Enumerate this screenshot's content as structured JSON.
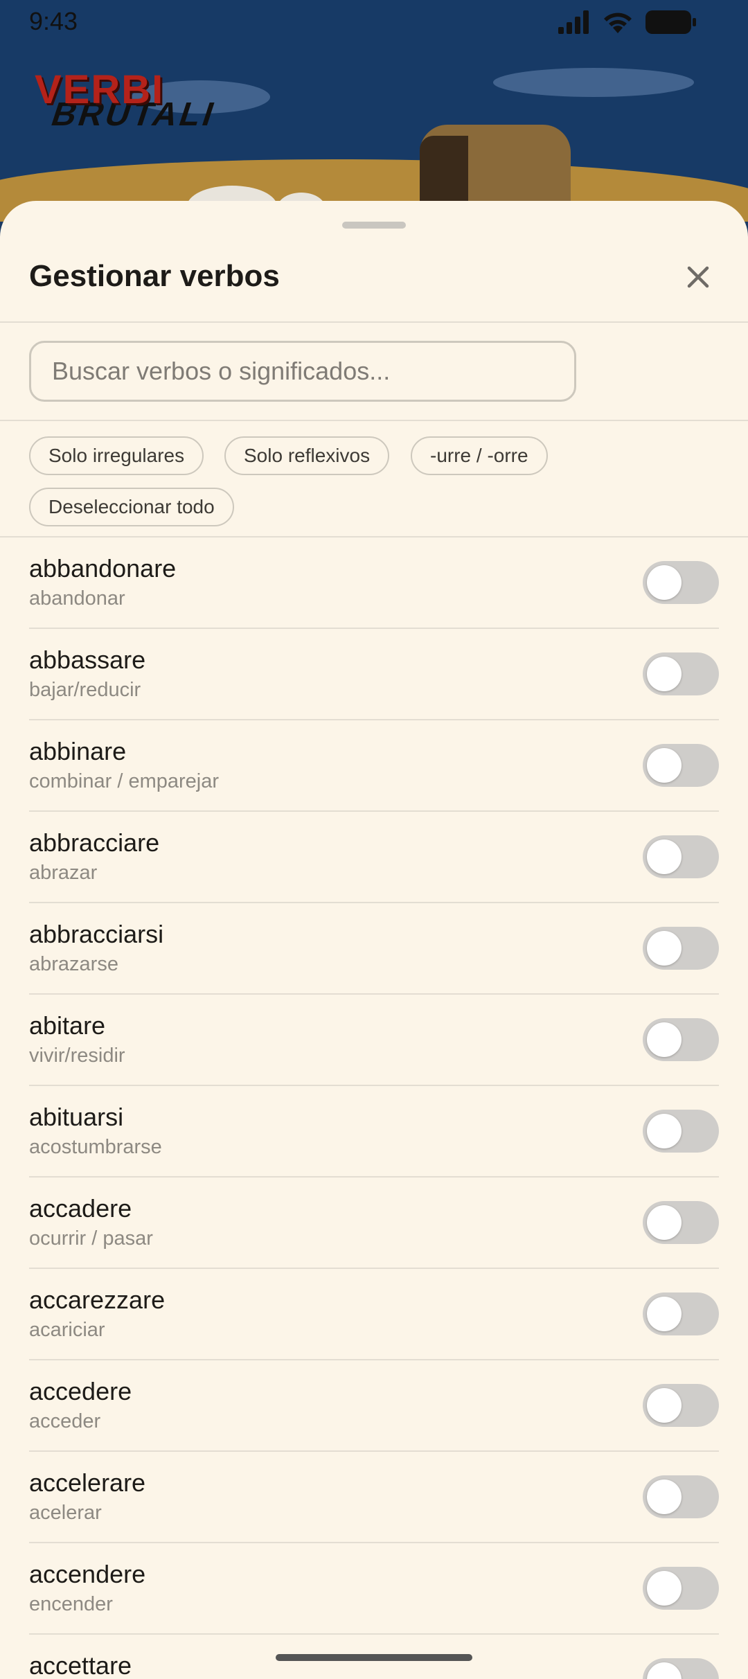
{
  "status_bar": {
    "time": "9:43"
  },
  "app": {
    "logo_main": "VERBI",
    "logo_sub": "BRUTALI"
  },
  "sheet": {
    "title": "Gestionar verbos",
    "search_placeholder": "Buscar verbos o significados...",
    "filters": [
      {
        "label": "Solo irregulares"
      },
      {
        "label": "Solo reflexivos"
      },
      {
        "label": "-urre / -orre"
      },
      {
        "label": "Deseleccionar todo"
      }
    ],
    "verbs": [
      {
        "name": "abbandonare",
        "meaning": "abandonar",
        "enabled": false
      },
      {
        "name": "abbassare",
        "meaning": "bajar/reducir",
        "enabled": false
      },
      {
        "name": "abbinare",
        "meaning": "combinar / emparejar",
        "enabled": false
      },
      {
        "name": "abbracciare",
        "meaning": "abrazar",
        "enabled": false
      },
      {
        "name": "abbracciarsi",
        "meaning": "abrazarse",
        "enabled": false
      },
      {
        "name": "abitare",
        "meaning": "vivir/residir",
        "enabled": false
      },
      {
        "name": "abituarsi",
        "meaning": "acostumbrarse",
        "enabled": false
      },
      {
        "name": "accadere",
        "meaning": "ocurrir / pasar",
        "enabled": false
      },
      {
        "name": "accarezzare",
        "meaning": "acariciar",
        "enabled": false
      },
      {
        "name": "accedere",
        "meaning": "acceder",
        "enabled": false
      },
      {
        "name": "accelerare",
        "meaning": "acelerar",
        "enabled": false
      },
      {
        "name": "accendere",
        "meaning": "encender",
        "enabled": false
      },
      {
        "name": "accettare",
        "meaning": "",
        "enabled": false
      }
    ]
  },
  "colors": {
    "sheet_background": "#fcf5e8",
    "toggle_off": "#cfcdca",
    "logo_red": "#b4221a"
  }
}
